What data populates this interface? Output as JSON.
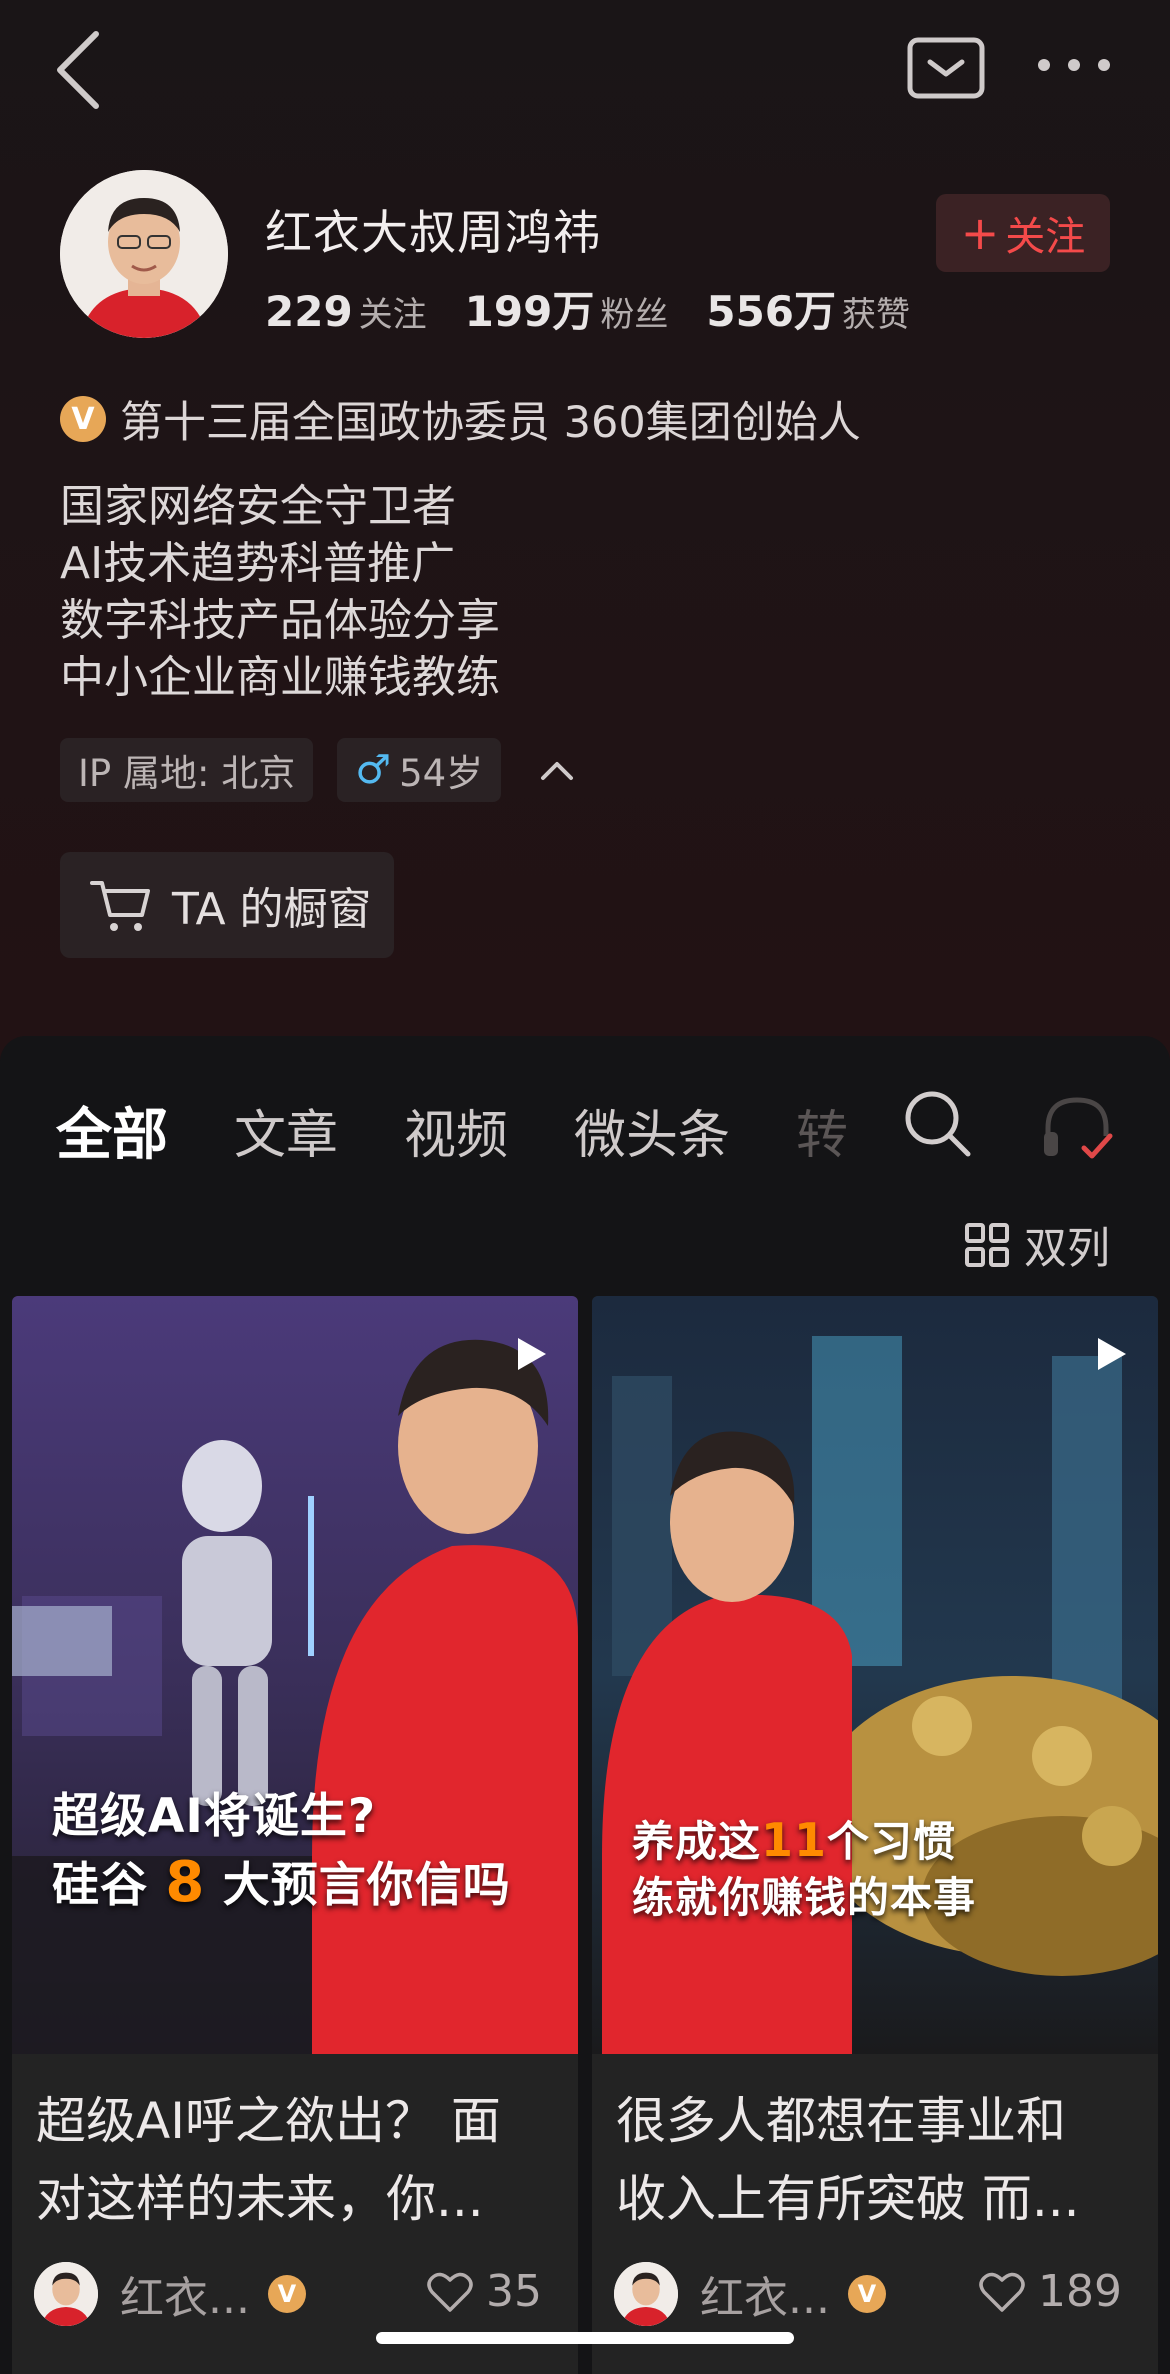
{
  "profile": {
    "name": "红衣大叔周鸿祎",
    "stats": [
      {
        "num": "229",
        "label": "关注"
      },
      {
        "num": "199万",
        "label": "粉丝"
      },
      {
        "num": "556万",
        "label": "获赞"
      }
    ],
    "follow_label": "关注",
    "follow_plus": "+",
    "verify_badge": "V",
    "verification": "第十三届全国政协委员 360集团创始人",
    "bio": [
      "国家网络安全守卫者",
      "AI技术趋势科普推广",
      "数字科技产品体验分享",
      "中小企业商业赚钱教练"
    ],
    "ip": "IP 属地: 北京",
    "gender_symbol": "♂",
    "age": "54岁",
    "shop_label": "TA 的橱窗"
  },
  "tabs": [
    "全部",
    "文章",
    "视频",
    "微头条",
    "转"
  ],
  "view_mode": "双列",
  "cards": [
    {
      "overlay_line1": "超级AI将诞生?",
      "overlay_line2_pre": "硅谷 ",
      "overlay_line2_hl": "8",
      "overlay_line2_post": " 大预言你信吗",
      "caption_line1": "超级AI呼之欲出？ 面",
      "caption_line2": "对这样的未来，你...",
      "author": "红衣...",
      "likes": "35"
    },
    {
      "overlay_line1_pre": "养成这",
      "overlay_line1_hl": "11",
      "overlay_line1_post": "个习惯",
      "overlay_line2": "练就你赚钱的本事",
      "caption_line1": "很多人都想在事业和",
      "caption_line2": "收入上有所突破 而...",
      "author": "红衣...",
      "likes": "189"
    }
  ],
  "colors": {
    "accent_red": "#f44a4a",
    "verify_gold": "#e7a757",
    "gender_blue": "#54b9f0",
    "highlight_orange": "#ff8a00"
  },
  "icons": [
    "back-arrow-icon",
    "message-icon",
    "more-icon",
    "cart-icon",
    "search-icon",
    "headphones-icon",
    "grid-icon",
    "play-icon",
    "heart-icon",
    "chevron-up-icon"
  ]
}
